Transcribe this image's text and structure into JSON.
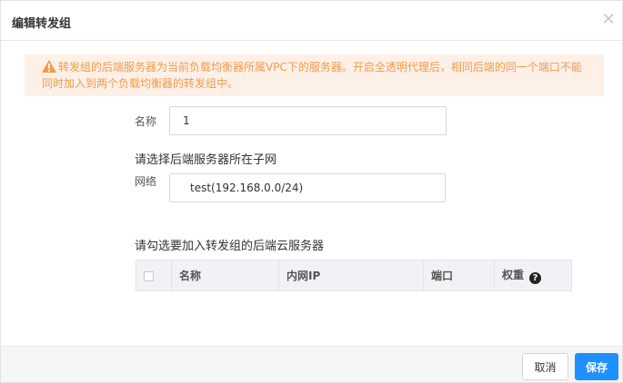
{
  "dialog": {
    "title": "编辑转发组",
    "close_icon": "close-icon"
  },
  "warning": {
    "icon": "warning-triangle-icon",
    "line1": "转发组的后端服务器为当前负载均衡器所属VPC下的服务器。开启全透明代理后，相同后端的同一个端口不能",
    "line2": "同时加入到两个负载均衡器的转发组中。",
    "color": "#f29b4a",
    "background": "#fdf0e7"
  },
  "form": {
    "name_label": "名称",
    "name_value": "1",
    "subnet_section": "请选择后端服务器所在子网",
    "network_label": "网络",
    "network_value": "test(192.168.0.0/24)",
    "servers_section": "请勾选要加入转发组的后端云服务器"
  },
  "table": {
    "headers": [
      "名称",
      "内网IP",
      "端口",
      "权重"
    ],
    "weight_help_icon": "question-circle-icon"
  },
  "footer": {
    "cancel_label": "取消",
    "save_label": "保存",
    "accent": "#1e90ff"
  }
}
